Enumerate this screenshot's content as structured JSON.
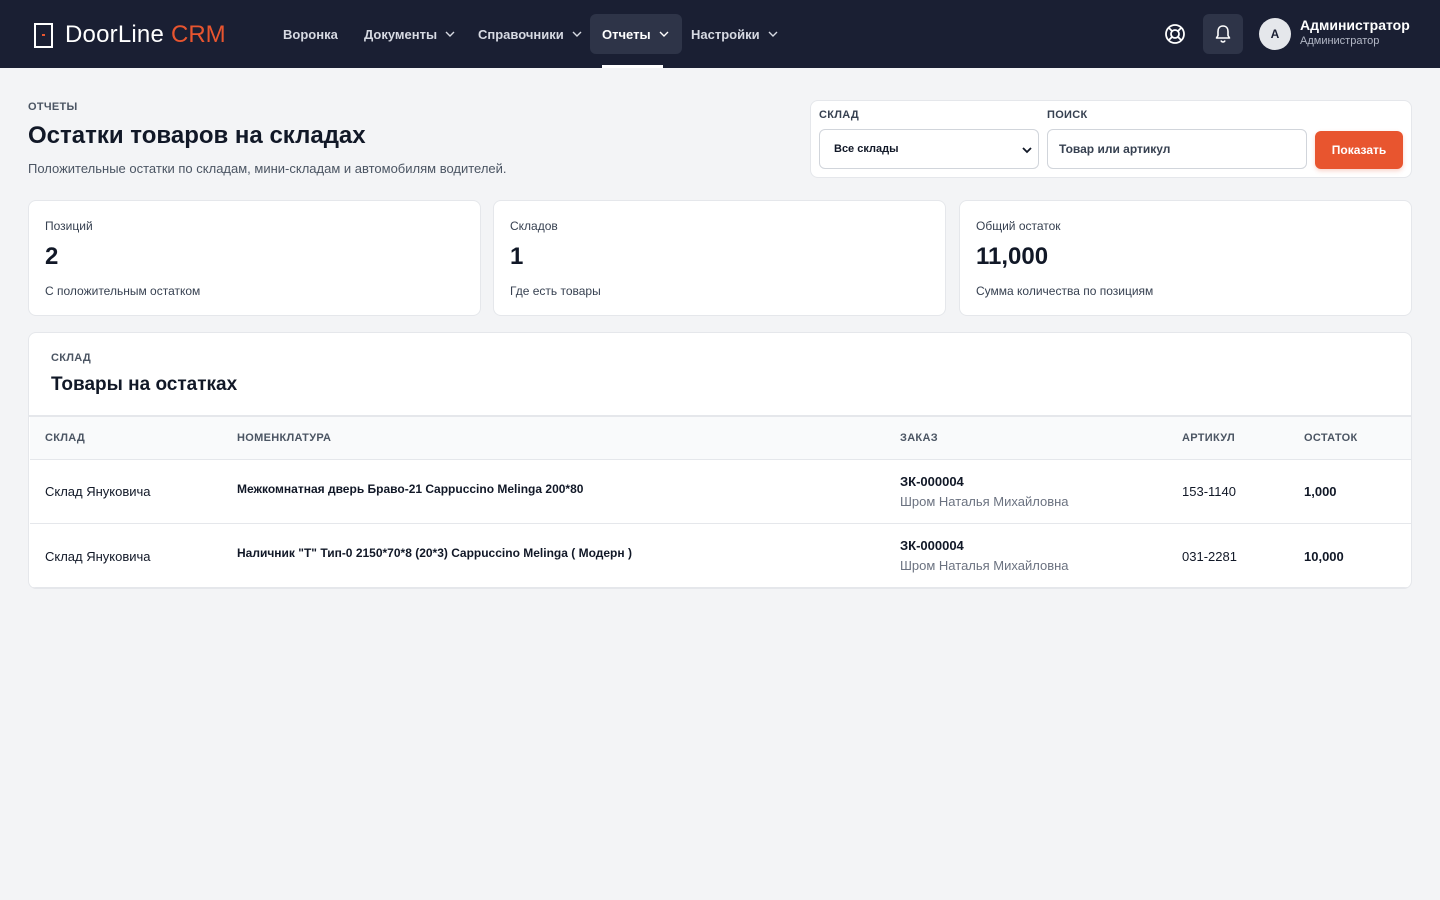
{
  "brand": {
    "name": "DoorLine",
    "suffix": "CRM"
  },
  "nav": {
    "items": [
      {
        "label": "Воронка"
      },
      {
        "label": "Документы"
      },
      {
        "label": "Справочники"
      },
      {
        "label": "Отчеты"
      },
      {
        "label": "Настройки"
      }
    ],
    "active": "Отчеты"
  },
  "user": {
    "initial": "А",
    "name": "Администратор",
    "role": "Администратор"
  },
  "header": {
    "eyebrow": "ОТЧЕТЫ",
    "title": "Остатки товаров на складах",
    "subtitle": "Положительные остатки по складам, мини-складам и автомобилям водителей."
  },
  "filters": {
    "warehouse_label": "СКЛАД",
    "warehouse_value": "Все склады",
    "search_label": "ПОИСК",
    "search_placeholder": "Товар или артикул",
    "show_button": "Показать"
  },
  "stats": [
    {
      "label": "Позиций",
      "value": "2",
      "note": "С положительным остатком"
    },
    {
      "label": "Складов",
      "value": "1",
      "note": "Где есть товары"
    },
    {
      "label": "Общий остаток",
      "value": "11,000",
      "note": "Сумма количества по позициям"
    }
  ],
  "table": {
    "eyebrow": "СКЛАД",
    "title": "Товары на остатках",
    "columns": [
      "СКЛАД",
      "НОМЕНКЛАТУРА",
      "ЗАКАЗ",
      "АРТИКУЛ",
      "ОСТАТОК"
    ],
    "rows": [
      {
        "warehouse": "Склад Януковича",
        "item": "Межкомнатная дверь Браво-21 Cappuccino Melinga 200*80",
        "order": "ЗК-000004",
        "customer": "Шром Наталья Михайловна",
        "sku": "153-1140",
        "qty": "1,000"
      },
      {
        "warehouse": "Склад Януковича",
        "item": "Наличник \"Т\" Тип-0 2150*70*8 (20*3) Cappuccino Melinga ( Модерн )",
        "order": "ЗК-000004",
        "customer": "Шром Наталья Михайловна",
        "sku": "031-2281",
        "qty": "10,000"
      }
    ]
  },
  "colors": {
    "nav_bg": "#1a1f33",
    "accent": "#e8552f",
    "page_bg": "#f3f4f6"
  },
  "icons": {
    "help": "lifebuoy-icon",
    "bell": "bell-icon",
    "chevron": "chevron-down-icon"
  }
}
